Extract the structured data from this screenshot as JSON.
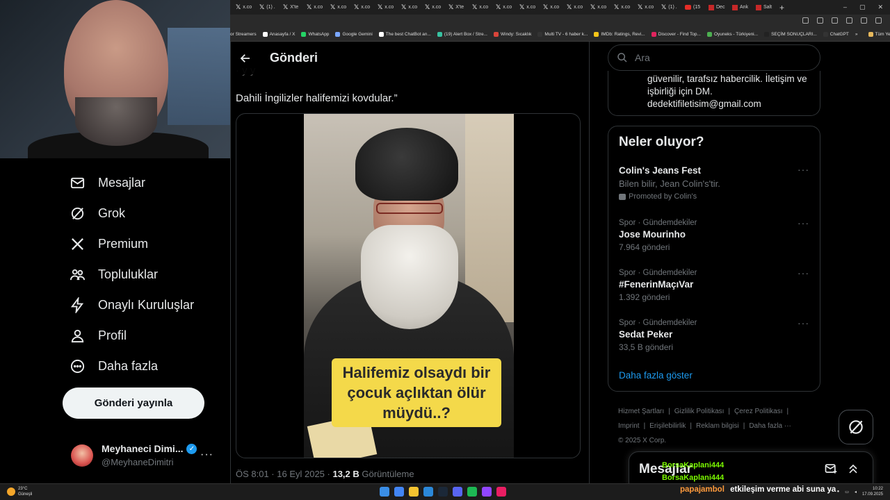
{
  "browser": {
    "tabs": [
      {
        "icon": "x",
        "label": "x.co"
      },
      {
        "icon": "x",
        "label": "(1) ."
      },
      {
        "icon": "x",
        "label": "X'te"
      },
      {
        "icon": "x",
        "label": "x.co"
      },
      {
        "icon": "x",
        "label": "x.co"
      },
      {
        "icon": "x",
        "label": "x.co"
      },
      {
        "icon": "x",
        "label": "x.co"
      },
      {
        "icon": "x",
        "label": "x.co"
      },
      {
        "icon": "x",
        "label": "x.co"
      },
      {
        "icon": "x",
        "label": "X'te"
      },
      {
        "icon": "x",
        "label": "x.co"
      },
      {
        "icon": "x",
        "label": "x.co"
      },
      {
        "icon": "x",
        "label": "x.co"
      },
      {
        "icon": "x",
        "label": "x.co"
      },
      {
        "icon": "x",
        "label": "x.co"
      },
      {
        "icon": "x",
        "label": "x.co"
      },
      {
        "icon": "x",
        "label": "x.co"
      },
      {
        "icon": "x",
        "label": "x.co"
      },
      {
        "icon": "x",
        "label": "(1) ."
      },
      {
        "icon": "yt",
        "label": "(15"
      },
      {
        "icon": "red",
        "label": "Dec"
      },
      {
        "icon": "red",
        "label": "Ank"
      },
      {
        "icon": "red",
        "label": "Salt"
      }
    ],
    "new_tab": "+",
    "window_controls": [
      "–",
      "▢",
      "✕"
    ],
    "bookmarks": [
      {
        "label": "or Streamers",
        "color": ""
      },
      {
        "label": "Anasayfa / X",
        "color": "#ffffff"
      },
      {
        "label": "WhatsApp",
        "color": "#25d366"
      },
      {
        "label": "Google Gemini",
        "color": "#7aa7ff"
      },
      {
        "label": "The best ChatBot an...",
        "color": "#ffffff"
      },
      {
        "label": "(19) Alert Box / Stre...",
        "color": "#37c2a1"
      },
      {
        "label": "Windy: Sıcaklık",
        "color": "#d9453a"
      },
      {
        "label": "Multi TV - 6 haber k...",
        "color": "#333333"
      },
      {
        "label": "IMDb: Ratings, Revi...",
        "color": "#f5c518"
      },
      {
        "label": "Discover - Find Top...",
        "color": "#e0245e"
      },
      {
        "label": "Oyuneks - Türkiyeni...",
        "color": "#4caf50"
      },
      {
        "label": "SEÇİM SONUÇLARI...",
        "color": "#222222"
      },
      {
        "label": "ChatGPT",
        "color": "#333333"
      },
      {
        "label": "»",
        "color": ""
      },
      {
        "label": "Tüm Yer İşaretleri",
        "color": "#e6b85c"
      }
    ]
  },
  "nav": {
    "items": [
      {
        "label": "Mesajlar",
        "icon": "mail-icon"
      },
      {
        "label": "Grok",
        "icon": "grok-icon"
      },
      {
        "label": "Premium",
        "icon": "x-logo-icon"
      },
      {
        "label": "Topluluklar",
        "icon": "communities-icon"
      },
      {
        "label": "Onaylı Kuruluşlar",
        "icon": "lightning-icon"
      },
      {
        "label": "Profil",
        "icon": "person-icon"
      },
      {
        "label": "Daha fazla",
        "icon": "more-circle-icon"
      }
    ],
    "post_button": "Gönderi yayınla",
    "profile": {
      "name": "Meyhaneci Dimi...",
      "handle": "@MeyhaneDimitri"
    }
  },
  "main": {
    "title": "Gönderi",
    "faded_line": "·                    y                    y",
    "tweet_text": "Dahili İngilizler halifemizi kovdular.”",
    "video_caption": "Halifemiz olsaydı bir çocuk açlıktan ölür müydü..?",
    "meta": {
      "time": "ÖS 8:01 · 16 Eyl 2025 · ",
      "views_count": "13,2 B",
      "views_label": " Görüntüleme"
    }
  },
  "right": {
    "search_placeholder": "Ara",
    "bio": "güvenilir, tarafsız habercilik. İletişim ve işbirliği için DM. dedektifiletisim@gmail.com",
    "trends_title": "Neler oluyor?",
    "promo": {
      "title": "Colin's Jeans Fest",
      "desc": "Bilen bilir, Jean Colin's'tir.",
      "promoted": "Promoted by Colin's"
    },
    "trends": [
      {
        "context": "Spor · Gündemdekiler",
        "title": "Jose Mourinho",
        "count": "7.964 gönderi"
      },
      {
        "context": "Spor · Gündemdekiler",
        "title": "#FenerinMaçıVar",
        "count": "1.392 gönderi"
      },
      {
        "context": "Spor · Gündemdekiler",
        "title": "Sedat Peker",
        "count": "33,5 B gönderi"
      }
    ],
    "show_more": "Daha fazla göster",
    "footer": [
      "Hizmet Şartları",
      "|",
      "Gizlilik Politikası",
      "|",
      "Çerez Politikası",
      "|",
      "Imprint",
      "|",
      "Erişilebilirlik",
      "|",
      "Reklam bilgisi",
      "|",
      "Daha fazla ···",
      "© 2025 X Corp."
    ],
    "messages_label": "Mesajlar"
  },
  "stream_overlay": {
    "chat": [
      {
        "user": "BorsaKaplani444",
        "color": "#7cfc00"
      },
      {
        "user": "BorsaKaplani444",
        "color": "#7cfc00"
      },
      {
        "user": "papajambol",
        "color": "#ff9a3c",
        "message": "etkileşim verme abi suna ya"
      }
    ]
  },
  "taskbar": {
    "weather_temp": "23°C",
    "weather_desc": "Güneşli",
    "time": "10:22",
    "date": "17.09.2025"
  }
}
